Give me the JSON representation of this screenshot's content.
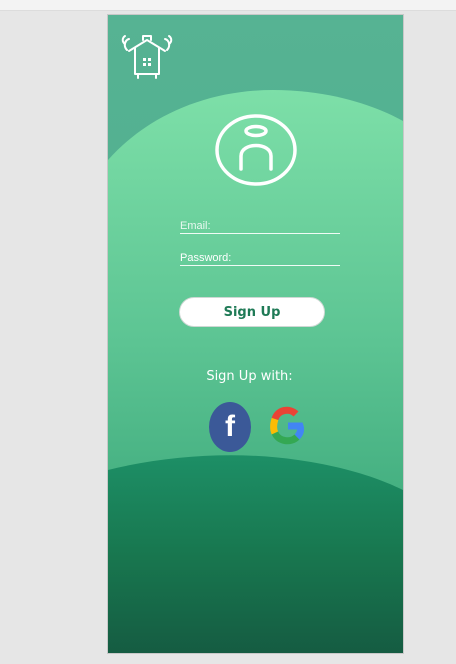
{
  "colors": {
    "background_top": "#4aa98a",
    "wave_light": "#7ddfa8",
    "wave_mid": "#3fae7e",
    "wave_dark": "#1a8a64",
    "bottom_dark": "#155c42",
    "button_text": "#1f7a56",
    "facebook_blue": "#3b5998"
  },
  "header": {
    "logo_icon": "house-shop-icon"
  },
  "profile": {
    "avatar_icon": "user-avatar-icon"
  },
  "form": {
    "email_label": "Email:",
    "password_label": "Password:",
    "signup_button": "Sign Up"
  },
  "social": {
    "label": "Sign Up with:",
    "facebook_letter": "f",
    "facebook_icon": "facebook-icon",
    "google_icon": "google-icon"
  }
}
